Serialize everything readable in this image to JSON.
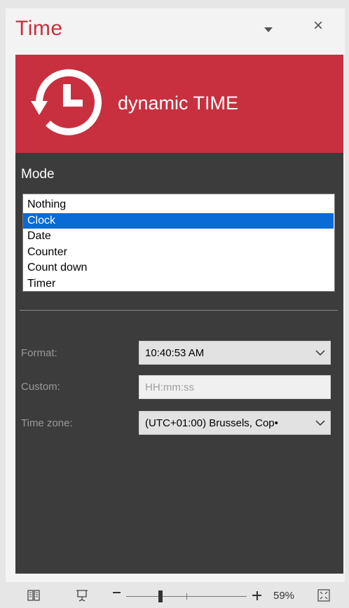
{
  "pane": {
    "title": "Time",
    "close_glyph": "×"
  },
  "banner": {
    "text": "dynamic TIME",
    "logo_icon": "clock-refresh-icon"
  },
  "mode": {
    "label": "Mode",
    "items": [
      "Nothing",
      "Clock",
      "Date",
      "Counter",
      "Count down",
      "Timer"
    ],
    "selected": "Clock"
  },
  "settings": {
    "format_label": "Format:",
    "format_value": "10:40:53 AM",
    "custom_label": "Custom:",
    "custom_placeholder": "HH:mm:ss",
    "custom_value": "",
    "timezone_label": "Time zone:",
    "timezone_value": "(UTC+01:00) Brussels, Cop•"
  },
  "statusbar": {
    "zoom_level": "59%",
    "zoom_minus": "-",
    "zoom_percent": 59
  },
  "colors": {
    "accent": "#c8303f",
    "panel": "#3c3c3c",
    "selection": "#0a6ad6"
  }
}
